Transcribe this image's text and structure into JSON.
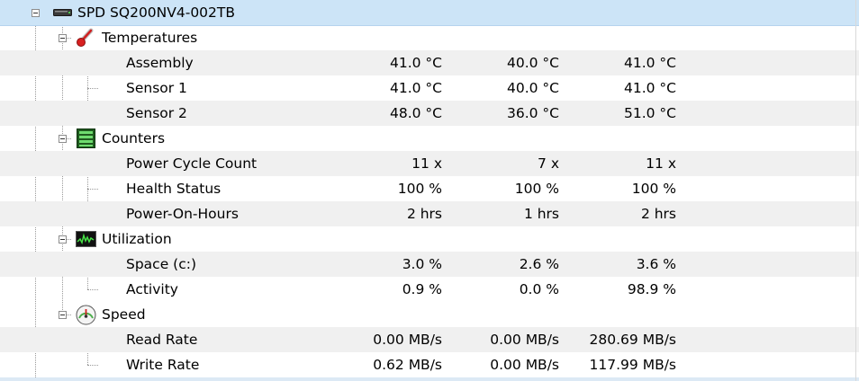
{
  "device": {
    "name": "SPD SQ200NV4-002TB",
    "icon": "drive-icon"
  },
  "groups": [
    {
      "label": "Temperatures",
      "icon": "thermometer-icon",
      "rows": [
        {
          "label": "Assembly",
          "v1": "41.0 °C",
          "v2": "40.0 °C",
          "v3": "41.0 °C"
        },
        {
          "label": "Sensor 1",
          "v1": "41.0 °C",
          "v2": "40.0 °C",
          "v3": "41.0 °C"
        },
        {
          "label": "Sensor 2",
          "v1": "48.0 °C",
          "v2": "36.0 °C",
          "v3": "51.0 °C"
        }
      ]
    },
    {
      "label": "Counters",
      "icon": "counter-icon",
      "rows": [
        {
          "label": "Power Cycle Count",
          "v1": "11 x",
          "v2": "7 x",
          "v3": "11 x"
        },
        {
          "label": "Health Status",
          "v1": "100 %",
          "v2": "100 %",
          "v3": "100 %"
        },
        {
          "label": "Power-On-Hours",
          "v1": "2 hrs",
          "v2": "1 hrs",
          "v3": "2 hrs"
        }
      ]
    },
    {
      "label": "Utilization",
      "icon": "activity-graph-icon",
      "rows": [
        {
          "label": "Space (c:)",
          "v1": "3.0 %",
          "v2": "2.6 %",
          "v3": "3.6 %"
        },
        {
          "label": "Activity",
          "v1": "0.9 %",
          "v2": "0.0 %",
          "v3": "98.9 %"
        }
      ]
    },
    {
      "label": "Speed",
      "icon": "speedometer-icon",
      "rows": [
        {
          "label": "Read Rate",
          "v1": "0.00 MB/s",
          "v2": "0.00 MB/s",
          "v3": "280.69 MB/s"
        },
        {
          "label": "Write Rate",
          "v1": "0.62 MB/s",
          "v2": "0.00 MB/s",
          "v3": "117.99 MB/s"
        }
      ]
    }
  ]
}
